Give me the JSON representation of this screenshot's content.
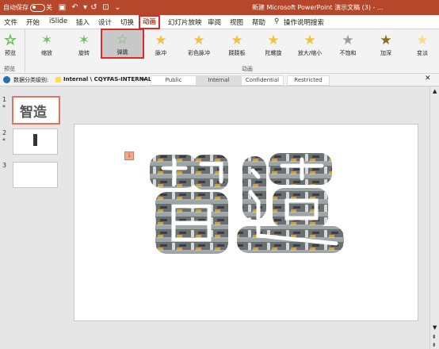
{
  "titlebar": {
    "autosave": "自动保存",
    "autosave_state": "关",
    "window_title": "新建 Microsoft PowerPoint 演示文稿 (3) - ...",
    "bg_color": "#b7472a"
  },
  "tabs": [
    "文件",
    "开始",
    "iSlide",
    "插入",
    "设计",
    "切换",
    "动画",
    "幻灯片放映",
    "审阅",
    "视图",
    "帮助"
  ],
  "active_tab": "动画",
  "search_label": "操作说明搜索",
  "ribbon": {
    "preview_label": "预览",
    "preview_group": "预览",
    "animation_group": "动画",
    "effects": [
      "缩放",
      "旋转",
      "弹跳",
      "脉冲",
      "彩色脉冲",
      "跷跷板",
      "陀螺旋",
      "放大/缩小",
      "不饱和",
      "加深",
      "变淡"
    ],
    "selected_effect": "弹跳"
  },
  "classification": {
    "label": "数据分类级别:",
    "path": "Internal \\ CQYFAS-INTERNAL",
    "options": [
      "Public",
      "Internal",
      "Confidential",
      "Restricted"
    ],
    "active": "Internal"
  },
  "thumbnails": [
    {
      "num": "1",
      "star": "*",
      "text": "智造"
    },
    {
      "num": "2",
      "star": "*",
      "text": ""
    },
    {
      "num": "3",
      "star": "",
      "text": ""
    }
  ],
  "slide": {
    "anim_tag": "1",
    "title_text": "智造"
  },
  "colors": {
    "accent_red": "#e02a2a",
    "ppt_orange": "#b7472a",
    "star_gold": "#f2c143",
    "star_green": "#6fbf5f"
  }
}
